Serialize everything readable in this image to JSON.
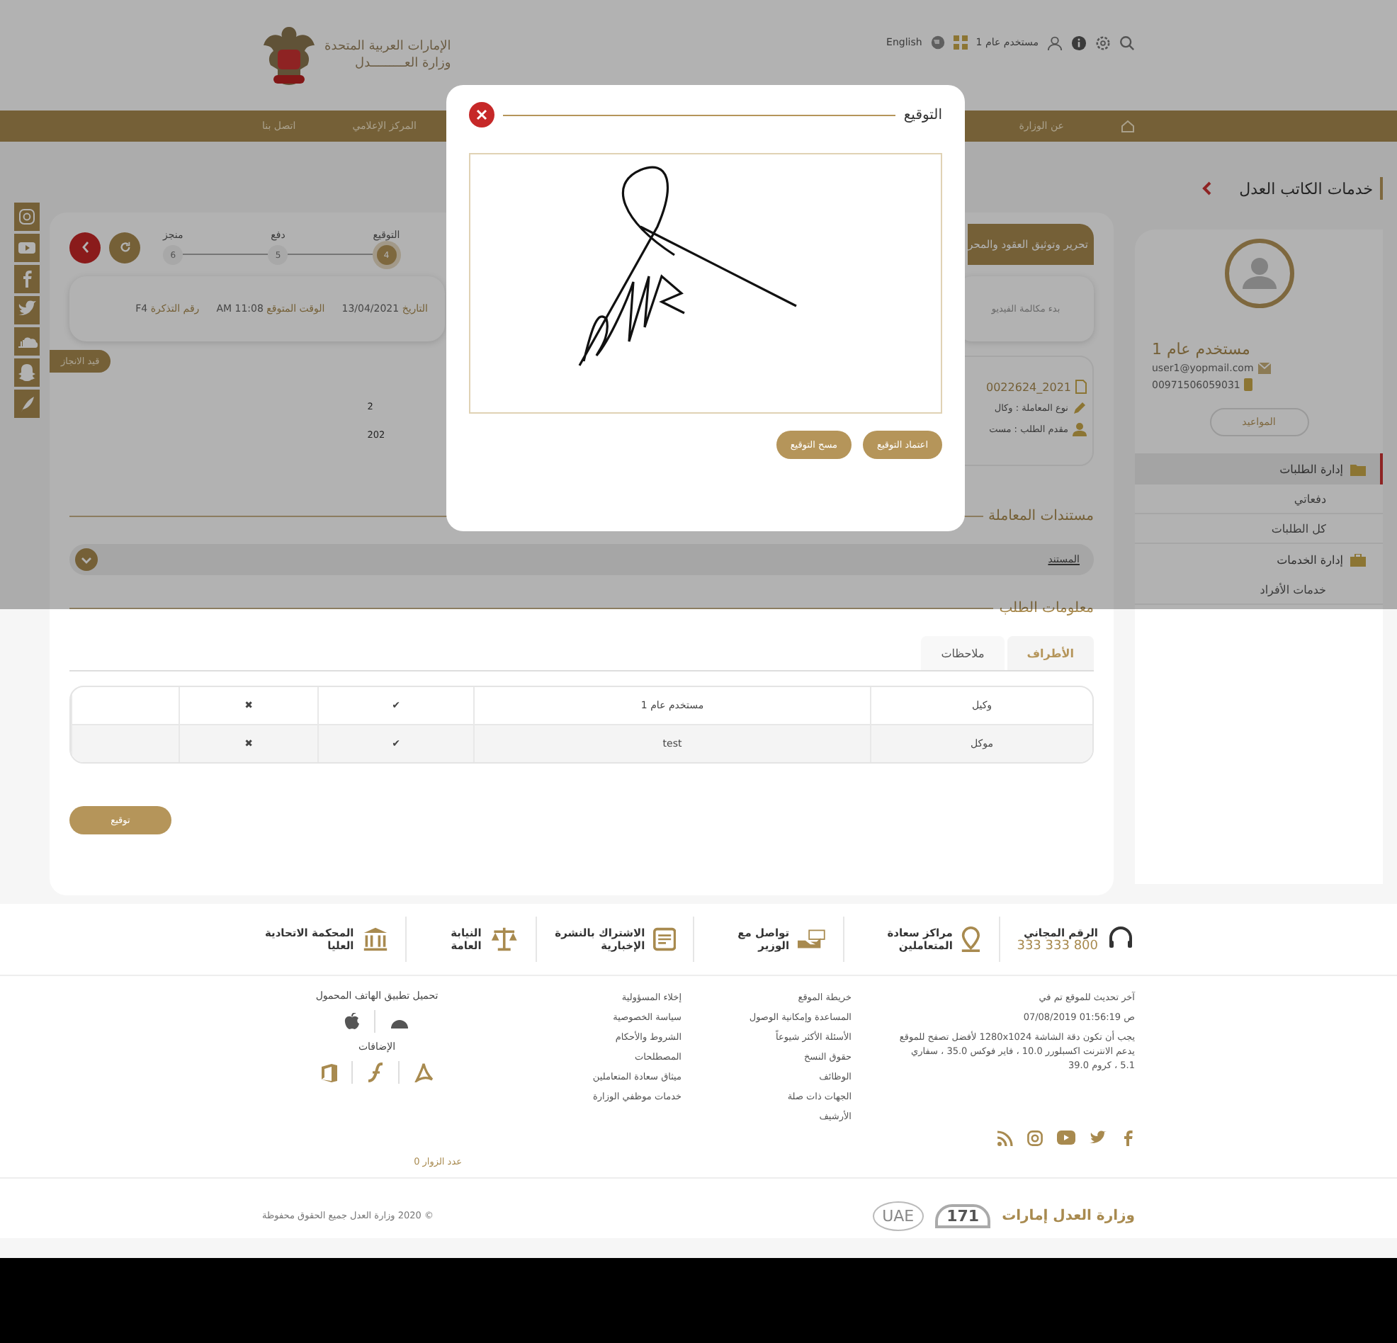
{
  "header": {
    "emblem_lines": [
      "الإمارات العربية المتحدة",
      "وزارة العـــــــــدل"
    ],
    "language": "English",
    "user": "مستخدم عام 1"
  },
  "nav_start": [
    "عن الوزارة"
  ],
  "nav_end": [
    "المركز الإعلامي",
    "اتصل بنا"
  ],
  "steps": [
    {
      "label": "التوقيع",
      "number": "4",
      "selected": true
    },
    {
      "label": "دفع",
      "number": "5",
      "selected": false
    },
    {
      "label": "منجز",
      "number": "6",
      "selected": false
    }
  ],
  "ticket": [
    {
      "label": "التاريخ",
      "value": "13/04/2021"
    },
    {
      "label": "الوقت المتوقع",
      "value": "AM 11:08"
    },
    {
      "label": "رقم التذكرة",
      "value": "F4"
    }
  ],
  "status_badge": "قيد الانجاز",
  "partial_texts": [
    "2",
    "202"
  ],
  "service_card": {
    "title": "تحرير وتوثيق العقود والمحر",
    "video_call": "بدء مكالمة الفيديو",
    "request_no": "2021_0022624",
    "type": "نوع المعاملة : وكال",
    "applicant": "مقدم الطلب : مست"
  },
  "documents": {
    "title": "مستندات المعاملة",
    "rows": [
      "المستند"
    ]
  },
  "request_info": {
    "title": "معلومات الطلب",
    "tabs": [
      {
        "label": "الأطراف",
        "selected": true
      },
      {
        "label": "ملاحظات",
        "selected": false
      }
    ],
    "rows": [
      [
        "وكيل",
        "مستخدم عام 1",
        "✔",
        "✖"
      ],
      [
        "موكل",
        "test",
        "✔",
        "✖"
      ]
    ],
    "sign_button": "توقيع"
  },
  "sidebar": {
    "title": "خدمات الكاتب العدل",
    "name": "مستخدم عام 1",
    "email": "user1@yopmail.com",
    "phone": "00971506059031",
    "appointments": "المواعيد",
    "menu": [
      {
        "label": "إدارة الطلبات",
        "selected": true,
        "children": [
          {
            "label": "دفعاتي",
            "selected": false
          },
          {
            "label": "كل الطلبات",
            "selected": false
          }
        ]
      },
      {
        "label": "إدارة الخدمات",
        "selected": false,
        "children": [
          {
            "label": "خدمات الأفراد",
            "selected": false
          }
        ]
      }
    ]
  },
  "modal": {
    "title": "التوقيع",
    "buttons": [
      "اعتماد التوقيع",
      "مسح التوقيع"
    ]
  },
  "footer": {
    "contacts": [
      {
        "kind": "phone",
        "title": "الرقم المجاني",
        "detail": "333 333 800"
      },
      {
        "kind": "location",
        "title": "مراكز سعادة المتعاملين"
      },
      {
        "kind": "minister",
        "title": "تواصل مع الوزير"
      },
      {
        "kind": "newsletter",
        "title": "الاشتراك بالنشرة الإخبارية"
      },
      {
        "kind": "prosecution",
        "title": "النيابة العامة"
      },
      {
        "kind": "court",
        "title": "المحكمة الاتحادية العليا"
      }
    ],
    "update_lines": [
      "آخر تحديث للموقع تم في",
      "ص 01:56:19 07/08/2019",
      "يجب أن تكون دقة الشاشة 1280x1024 لأفضل تصفح للموقع يدعم الانترنت اكسبلورر 10.0 ، فاير فوكس 35.0 ، سفاري 5.1 ، كروم 39.0"
    ],
    "links_1": [
      "خريطة الموقع",
      "المساعدة وإمكانية الوصول",
      "الأسئلة الأكثر شيوعاً",
      "حقوق النسخ",
      "الوظائف",
      "الجهات ذات صلة",
      "الأرشيف"
    ],
    "links_2": [
      "إخلاء المسؤولية",
      "سياسة الخصوصية",
      "الشروط والأحكام",
      "المصطلحات",
      "ميثاق سعادة المتعاملين",
      "خدمات موظفي الوزارة"
    ],
    "app_title": "تحميل تطبيق الهاتف المحمول",
    "plugins_title": "الإضافات",
    "visitors": "عدد الزوار 0",
    "brand": "وزارة العدل إمارات",
    "logo_171": "171",
    "logo_uae": "UAE",
    "copyright": "© 2020 وزارة العدل جميع الحقوق محفوظة"
  }
}
